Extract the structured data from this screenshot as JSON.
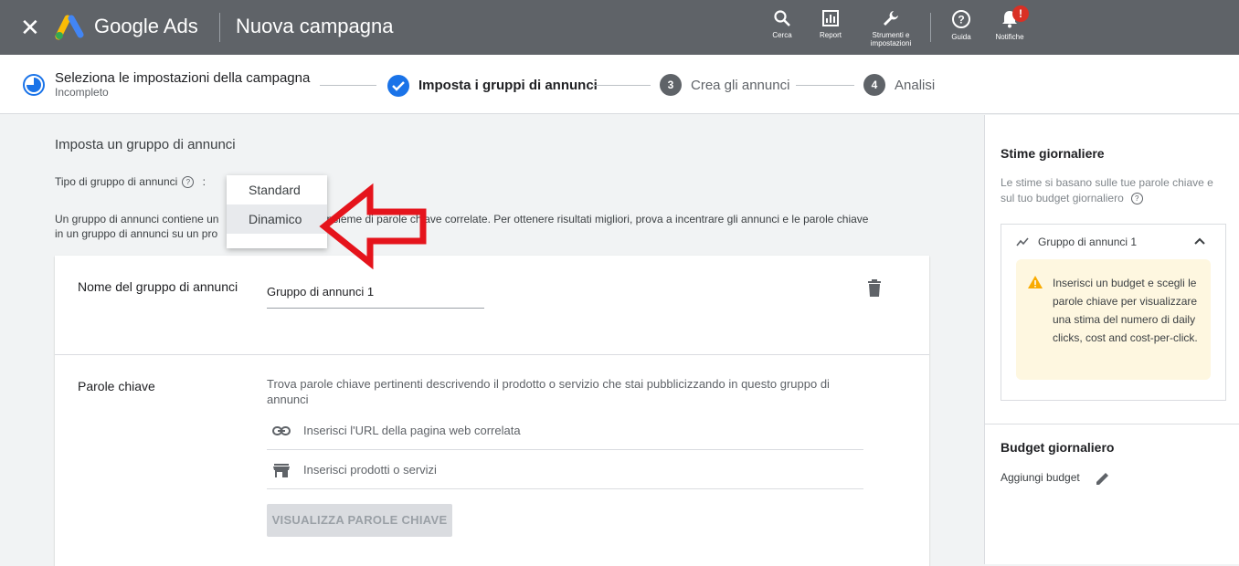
{
  "topbar": {
    "brand": "Google Ads",
    "page_title": "Nuova campagna",
    "tools": [
      {
        "icon": "search-icon",
        "label": "Cerca"
      },
      {
        "icon": "report-icon",
        "label": "Report"
      },
      {
        "icon": "wrench-icon",
        "label": "Strumenti e impostazioni"
      },
      {
        "icon": "help-icon",
        "label": "Guida"
      },
      {
        "icon": "bell-icon",
        "label": "Notifiche",
        "badge": "!"
      }
    ],
    "colors": {
      "bar": "#5f6368",
      "badge": "#d93025"
    }
  },
  "stepper": {
    "steps": [
      {
        "title": "Seleziona le impostazioni della campagna",
        "sub": "Incompleto",
        "state": "incomplete"
      },
      {
        "title": "Imposta i gruppi di annunci",
        "state": "current"
      },
      {
        "number": "3",
        "title": "Crea gli annunci",
        "state": "pending"
      },
      {
        "number": "4",
        "title": "Analisi",
        "state": "pending"
      }
    ],
    "accent": "#1a73e8"
  },
  "main": {
    "section_title": "Imposta un gruppo di annunci",
    "type_label": "Tipo di gruppo di annunci",
    "type_colon": ":",
    "description_left": "Un gruppo di annunci contiene un",
    "description_right": "insieme di parole chiave correlate. Per ottenere risultati migliori, prova a incentrare gli annunci e le parole chiave",
    "description_line2": "in un gruppo di annunci su un pro",
    "dropdown": {
      "options": [
        "Standard",
        "Dinamico"
      ],
      "highlighted": "Dinamico"
    },
    "card": {
      "name_label": "Nome del gruppo di annunci",
      "name_value": "Gruppo di annunci 1",
      "keywords_label": "Parole chiave",
      "keywords_desc": "Trova parole chiave pertinenti descrivendo il prodotto o servizio che stai pubblicizzando in questo gruppo di annunci",
      "url_placeholder": "Inserisci l'URL della pagina web correlata",
      "products_placeholder": "Inserisci prodotti o servizi",
      "show_keywords_button": "VISUALIZZA PAROLE CHIAVE"
    },
    "annotation_color": "#e5141c"
  },
  "right_panel": {
    "title": "Stime giornaliere",
    "subtitle": "Le stime si basano sulle tue parole chiave e sul tuo budget giornaliero",
    "group_name": "Gruppo di annunci 1",
    "warning": "Inserisci un budget e scegli le parole chiave per visualizzare una stima del numero di daily clicks, cost and cost-per-click.",
    "budget_title": "Budget giornaliero",
    "add_budget": "Aggiungi budget"
  }
}
